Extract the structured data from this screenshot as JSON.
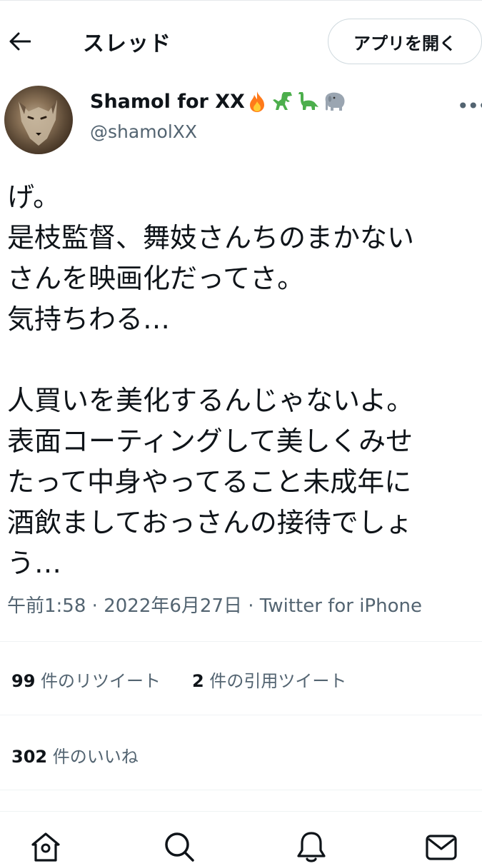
{
  "header": {
    "title": "スレッド",
    "open_app_label": "アプリを開く",
    "back_icon": "back-arrow-icon"
  },
  "author": {
    "display_name": "Shamol for XX",
    "emojis": [
      "fire",
      "t-rex",
      "sauropod",
      "elephant"
    ],
    "handle": "@shamolXX",
    "avatar": "wolf-avatar"
  },
  "tweet": {
    "lines": [
      "げ。",
      "是枝監督、舞妓さんちのまかない",
      "さんを映画化だってさ。",
      "気持ちわる…",
      "",
      "人買いを美化するんじゃないよ。",
      "表面コーティングして美しくみせ",
      "たって中身やってること未成年に",
      "酒飲ましておっさんの接待でしょ",
      "う…"
    ]
  },
  "meta": {
    "time": "午前1:58",
    "separator": " · ",
    "date": "2022年6月27日",
    "source": "Twitter for iPhone"
  },
  "stats": {
    "retweets_count": "99",
    "retweets_label": " 件のリツイート",
    "quotes_count": "2",
    "quotes_label": " 件の引用ツイート",
    "likes_count": "302",
    "likes_label": " 件のいいね"
  },
  "tabbar": {
    "icons": [
      "home-icon",
      "search-icon",
      "notifications-icon",
      "messages-icon"
    ]
  },
  "colors": {
    "text": "#0f1419",
    "secondary": "#536471",
    "border": "#cfd9de",
    "divider": "#eff3f4"
  }
}
